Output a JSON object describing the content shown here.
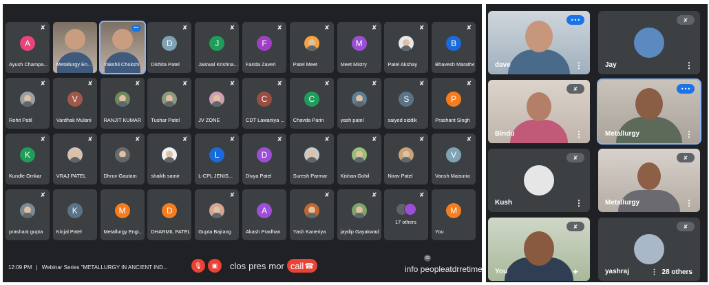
{
  "meeting": {
    "participants": [
      {
        "name": "Ayush Champa...",
        "initial": "A",
        "color": "#e8457a",
        "muted": true,
        "kind": "letter"
      },
      {
        "name": "Metallurgy En...",
        "muted": false,
        "kind": "video"
      },
      {
        "name": "Yakshil Chokshi",
        "muted": false,
        "kind": "video",
        "speaking": true
      },
      {
        "name": "Dishita Patel",
        "initial": "D",
        "color": "#7fa2b5",
        "muted": true,
        "kind": "letter"
      },
      {
        "name": "Jaiswal Krishna...",
        "initial": "J",
        "color": "#1e9e5a",
        "muted": true,
        "kind": "letter"
      },
      {
        "name": "Farida Zaveri",
        "initial": "F",
        "color": "#9e3fc4",
        "muted": true,
        "kind": "letter"
      },
      {
        "name": "Patel Meet",
        "muted": true,
        "kind": "photo",
        "color": "#f4a340"
      },
      {
        "name": "Meet Mistry",
        "initial": "M",
        "color": "#9c4fd6",
        "muted": true,
        "kind": "letter"
      },
      {
        "name": "Patel Akshay",
        "muted": true,
        "kind": "photo",
        "color": "#e8e8e8"
      },
      {
        "name": "Bhavesh Marathe",
        "initial": "B",
        "color": "#1a6bd8",
        "muted": true,
        "kind": "letter"
      },
      {
        "name": "Rohit Patil",
        "muted": true,
        "kind": "photo",
        "color": "#9aa0a6"
      },
      {
        "name": "Vardhak Mulani",
        "initial": "V",
        "color": "#a0584b",
        "muted": true,
        "kind": "letter"
      },
      {
        "name": "RANJIT KUMAR",
        "muted": true,
        "kind": "photo",
        "color": "#6f8a5c"
      },
      {
        "name": "Tushar Patel",
        "muted": true,
        "kind": "photo",
        "color": "#8c9a7c"
      },
      {
        "name": "JV ZONE",
        "muted": true,
        "kind": "photo",
        "color": "#d0a0b0"
      },
      {
        "name": "CDT Lawaniya ...",
        "initial": "C",
        "color": "#9b4d43",
        "muted": true,
        "kind": "letter"
      },
      {
        "name": "Chavda Parin",
        "initial": "C",
        "color": "#1e9e5a",
        "muted": true,
        "kind": "letter"
      },
      {
        "name": "yash patel",
        "muted": true,
        "kind": "photo",
        "color": "#5e7f93"
      },
      {
        "name": "saiyed siddik",
        "initial": "S",
        "color": "#5a7386",
        "muted": true,
        "kind": "letter"
      },
      {
        "name": "Prashant Singh",
        "initial": "P",
        "color": "#f57c1f",
        "muted": true,
        "kind": "letter"
      },
      {
        "name": "Kundle Omkar",
        "initial": "K",
        "color": "#1e9e5a",
        "muted": true,
        "kind": "letter"
      },
      {
        "name": "VRAJ PATEL",
        "muted": true,
        "kind": "photo",
        "color": "#d6c2b0"
      },
      {
        "name": "Dhruv Gautam",
        "muted": true,
        "kind": "photo",
        "color": "#6b6b6b"
      },
      {
        "name": "shaikh samir",
        "muted": true,
        "kind": "photo",
        "color": "#f0f0f0"
      },
      {
        "name": "L-CPL JENIS...",
        "initial": "L",
        "color": "#1a6bd8",
        "muted": true,
        "kind": "letter"
      },
      {
        "name": "Divya Patel",
        "initial": "D",
        "color": "#9c4fd6",
        "muted": true,
        "kind": "letter"
      },
      {
        "name": "Suresh Parmar",
        "muted": true,
        "kind": "photo",
        "color": "#c9c9c9"
      },
      {
        "name": "Kishan Gohil",
        "muted": true,
        "kind": "photo",
        "color": "#9bbf7a"
      },
      {
        "name": "Nirav Patel",
        "muted": true,
        "kind": "photo",
        "color": "#c9a27a"
      },
      {
        "name": "Vansh Maisuria",
        "initial": "V",
        "color": "#7fa2b5",
        "muted": true,
        "kind": "letter"
      },
      {
        "name": "prashant gupta",
        "muted": true,
        "kind": "photo",
        "color": "#7c8a96"
      },
      {
        "name": "Kinjal Patel",
        "initial": "K",
        "color": "#5a7386",
        "muted": false,
        "kind": "letter"
      },
      {
        "name": "Metallurgy Engi...",
        "initial": "M",
        "color": "#f57c1f",
        "muted": false,
        "kind": "letter"
      },
      {
        "name": "DHARMIL PATEL",
        "initial": "D",
        "color": "#f57c1f",
        "muted": false,
        "kind": "letter"
      },
      {
        "name": "Gupta Bajrang",
        "muted": true,
        "kind": "photo",
        "color": "#d4a592"
      },
      {
        "name": "Akash Pradhan",
        "initial": "A",
        "color": "#9c4fd6",
        "muted": false,
        "kind": "letter"
      },
      {
        "name": "Yash Kaneriya",
        "muted": true,
        "kind": "photo",
        "color": "#c0662e"
      },
      {
        "name": "jaydip Gayakwad",
        "muted": true,
        "kind": "photo",
        "color": "#7fa36b"
      },
      {
        "name": "17 others",
        "muted": true,
        "kind": "others"
      },
      {
        "name": "You",
        "initial": "M",
        "color": "#f57c1f",
        "muted": false,
        "kind": "letter"
      }
    ],
    "bottom": {
      "time": "12:09 PM",
      "separator": "|",
      "title": "Webinar Series \"METALLURGY IN ANCIENT IND...",
      "controls_text": [
        "clos",
        "pres",
        "mor"
      ],
      "call_label": "call",
      "right_text": "info peopleatdrretimes",
      "badge": "59"
    }
  },
  "side": {
    "tiles": [
      {
        "name": "dave",
        "kind": "video",
        "speaking": true
      },
      {
        "name": "Jay",
        "kind": "avatar",
        "muted": true
      },
      {
        "name": "Bindu",
        "kind": "video",
        "muted": true
      },
      {
        "name": "Metallurgy",
        "kind": "video",
        "speaking": true
      },
      {
        "name": "Kush",
        "kind": "avatar",
        "muted": true
      },
      {
        "name": "Metallurgy",
        "kind": "video",
        "muted": true
      },
      {
        "name": "You",
        "kind": "video",
        "muted": true
      },
      {
        "name": "yashraj",
        "kind": "avatar",
        "muted": true
      }
    ],
    "more_label": "28 others"
  },
  "colors": {
    "bg": "#202124",
    "tile": "#3c4043",
    "accent": "#1a73e8",
    "red": "#ea4335"
  },
  "icons": {
    "mic_off": "mic-off-icon",
    "speaking": "speaking-icon",
    "more": "more-options-icon"
  }
}
